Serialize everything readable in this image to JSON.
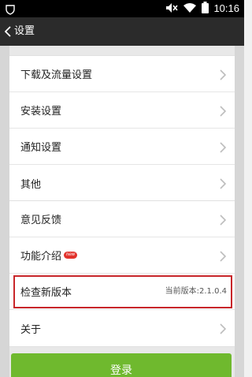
{
  "status_bar": {
    "time": "10:16",
    "icons": [
      "shield-icon",
      "mute-icon",
      "wifi-icon",
      "battery-icon"
    ]
  },
  "app_bar": {
    "title": "设置",
    "back_icon": "chevron-left-icon"
  },
  "settings_group_1": [
    {
      "label": "下载及流量设置"
    },
    {
      "label": "安装设置"
    },
    {
      "label": "通知设置"
    },
    {
      "label": "其他"
    }
  ],
  "settings_group_2": [
    {
      "label": "意见反馈"
    },
    {
      "label": "功能介绍",
      "badge": "new"
    },
    {
      "label": "检查新版本",
      "value": "当前版本:2.1.0.4"
    },
    {
      "label": "关于"
    }
  ],
  "login_button": {
    "label": "登录"
  },
  "colors": {
    "app_bar": "#2b2b2b",
    "login_button": "#6fb92e",
    "highlight": "#c8262a",
    "badge": "#e2322c"
  }
}
